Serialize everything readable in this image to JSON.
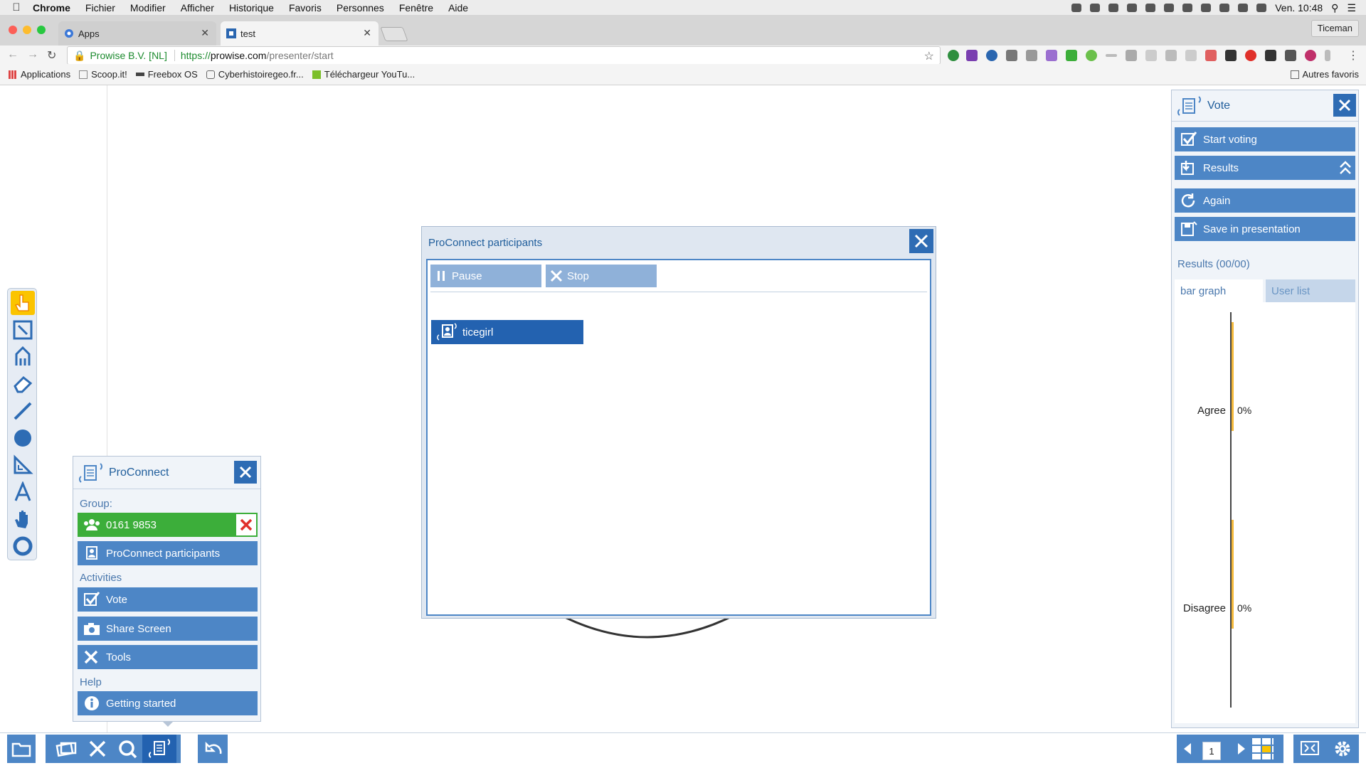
{
  "menubar": {
    "app": "Chrome",
    "items": [
      "Fichier",
      "Modifier",
      "Afficher",
      "Historique",
      "Favoris",
      "Personnes",
      "Fenêtre",
      "Aide"
    ],
    "clock": "Ven. 10:48"
  },
  "tabs": [
    {
      "label": "Apps",
      "active": false
    },
    {
      "label": "test",
      "active": true
    }
  ],
  "profile": "Ticeman",
  "address": {
    "security_label": "Prowise B.V. [NL]",
    "scheme": "https://",
    "host": "prowise.com",
    "path": "/presenter/start"
  },
  "bookmarks": [
    "Applications",
    "Scoop.it!",
    "Freebox OS",
    "Cyberhistoiregeo.fr...",
    "Téléchargeur YouTu..."
  ],
  "bookmarks_other": "Autres favoris",
  "proconnect": {
    "title": "ProConnect",
    "group_label": "Group:",
    "group_code": "0161 9853",
    "participants_button": "ProConnect participants",
    "activities_label": "Activities",
    "activities": [
      "Vote",
      "Share Screen",
      "Tools"
    ],
    "help_label": "Help",
    "help_button": "Getting started"
  },
  "participants_dialog": {
    "title": "ProConnect participants",
    "pause": "Pause",
    "stop": "Stop",
    "participants": [
      "ticegirl"
    ]
  },
  "vote": {
    "title": "Vote",
    "buttons": [
      "Start voting",
      "Results",
      "Again",
      "Save in presentation"
    ],
    "results_label": "Results (00/00)",
    "tab_bar": "bar graph",
    "tab_list": "User list",
    "bar_color": "#f4b93b"
  },
  "chart_data": {
    "type": "bar",
    "categories": [
      "Agree",
      "Disagree"
    ],
    "values": [
      0,
      0
    ],
    "value_labels": [
      "0%",
      "0%"
    ]
  },
  "pager": {
    "page": "1"
  },
  "colors": {
    "accent": "#4d86c6",
    "dark_accent": "#2362b0",
    "group_green": "#3cae3a",
    "tool_selected": "#fbc400"
  }
}
